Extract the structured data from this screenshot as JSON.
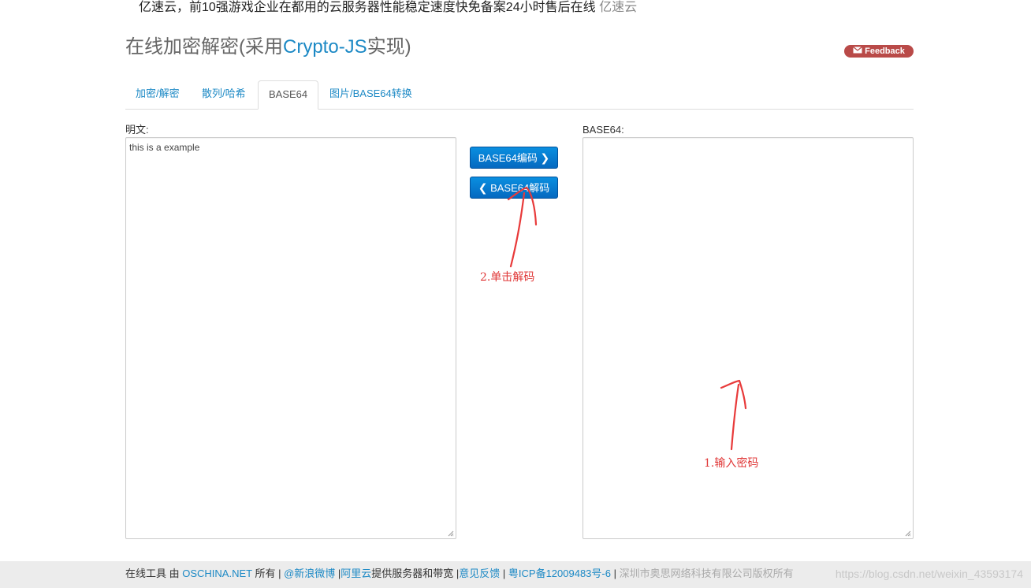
{
  "ad": {
    "text": "亿速云，前10强游戏企业在都用的云服务器性能稳定速度快免备案24小时售后在线",
    "brand": "亿速云"
  },
  "header": {
    "title_prefix": "在线加密解密(采用",
    "title_accent": "Crypto-JS",
    "title_suffix": "实现)",
    "feedback_label": "Feedback"
  },
  "tabs": [
    {
      "label": "加密/解密",
      "active": false
    },
    {
      "label": "散列/哈希",
      "active": false
    },
    {
      "label": "BASE64",
      "active": true
    },
    {
      "label": "图片/BASE64转换",
      "active": false
    }
  ],
  "left_panel": {
    "label": "明文:",
    "value": "this is a example"
  },
  "right_panel": {
    "label": "BASE64:",
    "value": ""
  },
  "buttons": {
    "encode_label": "BASE64编码",
    "decode_label": "BASE64解码"
  },
  "annotations": {
    "step2": "2.单击解码",
    "step1": "1.输入密码"
  },
  "footer": {
    "prefix": "在线工具 由 ",
    "oschina": "OSCHINA.NET",
    "owned": " 所有 | ",
    "weibo": "@新浪微博",
    "sep1": " |",
    "aliyun": "阿里云",
    "provides": "提供服务器和带宽 |",
    "feedback": "意见反馈",
    "sep2": " | ",
    "icp": "粤ICP备12009483号-6",
    "sep3": " | ",
    "company": "深圳市奥思网络科技有限公司版权所有"
  },
  "watermark": "https://blog.csdn.net/weixin_43593174",
  "colors": {
    "link": "#1c89c5",
    "button": "#0a7fd6",
    "feedback_badge": "#b94a48",
    "annotation": "#e03838"
  }
}
